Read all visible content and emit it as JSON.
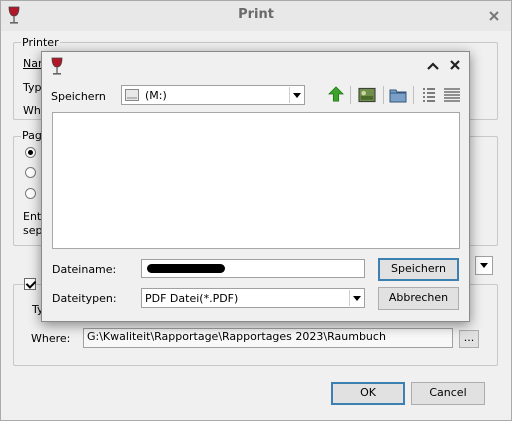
{
  "print_dialog": {
    "title": "Print",
    "printer_group": {
      "legend": "Printer",
      "name_label": "Nam",
      "type_label": "Typ",
      "where_label": "Whe"
    },
    "page_group": {
      "legend": "Pag",
      "radios": [
        {
          "label": "",
          "selected": true
        },
        {
          "label": "",
          "selected": false
        },
        {
          "label": "",
          "selected": false
        }
      ],
      "enter_text_line1": "Ent",
      "enter_text_line2": "sep"
    },
    "output_group": {
      "type_label": "Ty",
      "where_label": "Where:",
      "where_value": "G:\\Kwaliteit\\Rapportage\\Rapportages 2023\\Raumbuch",
      "browse_label": "..."
    },
    "ok_label": "OK",
    "cancel_label": "Cancel"
  },
  "save_dialog": {
    "save_in_label": "Speichern",
    "location_value": "(M:)",
    "filename_label": "Dateiname:",
    "filetype_label": "Dateitypen:",
    "filetype_value": "PDF Datei(*.PDF)",
    "save_button": "Speichern",
    "cancel_button": "Abbrechen",
    "toolbar_icons": [
      "up-folder-icon",
      "desktop-icon",
      "new-folder-icon",
      "list-view-icon",
      "details-view-icon"
    ]
  },
  "colors": {
    "accent": "#3c7fb1",
    "up_arrow_green": "#3aa32a",
    "wine_red": "#b0182a"
  }
}
